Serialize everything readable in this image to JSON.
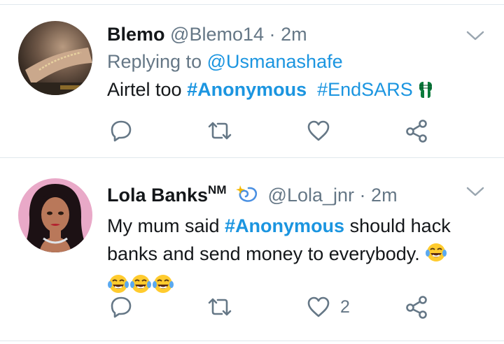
{
  "tweets": [
    {
      "name": "Blemo",
      "handle": "@Blemo14",
      "separator": "·",
      "time": "2m",
      "replying_label": "Replying to",
      "replying_to": "@Usmanashafe",
      "text_1": "Airtel too",
      "hashtag_1": "#Anonymous",
      "hashtag_2": "#EndSARS",
      "reply_count": "",
      "retweet_count": "",
      "like_count": ""
    },
    {
      "name": "Lola Banks",
      "name_sup": "NM",
      "handle": "@Lola_jnr",
      "separator": "·",
      "time": "2m",
      "text_1": "My mum said",
      "hashtag_1": "#Anonymous",
      "text_2": "should hack",
      "text_3": "banks and send money to everybody.",
      "reply_count": "",
      "retweet_count": "",
      "like_count": "2"
    }
  ],
  "colors": {
    "link": "#1b95e0",
    "secondary": "#657786",
    "divider": "#e1e8ed"
  },
  "icons": [
    "reply-icon",
    "retweet-icon",
    "like-icon",
    "share-icon",
    "chevron-down-icon",
    "dizzy-emoji",
    "raised-fist-emoji",
    "laughing-tears-emoji"
  ]
}
